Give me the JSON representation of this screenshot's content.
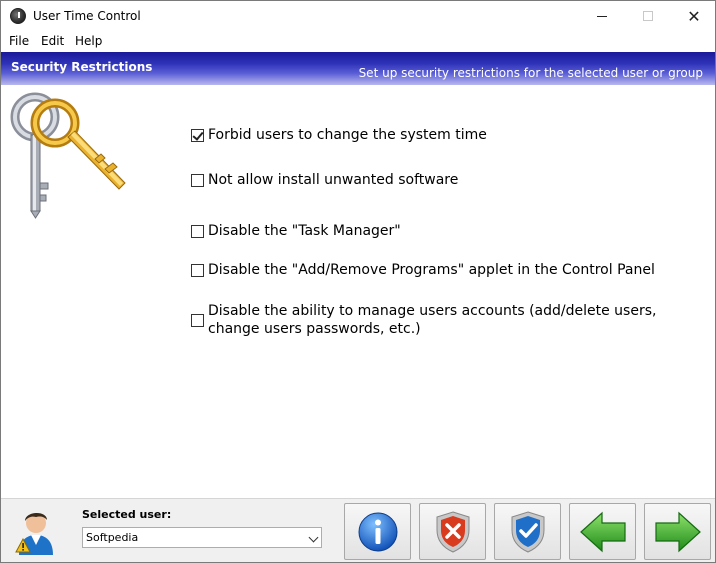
{
  "window": {
    "title": "User Time Control"
  },
  "menu": {
    "items": [
      "File",
      "Edit",
      "Help"
    ]
  },
  "header": {
    "title": "Security Restrictions",
    "subtitle": "Set up security restrictions for the selected user or group"
  },
  "options": [
    {
      "label": "Forbid users to change the system time",
      "checked": true
    },
    {
      "label": "Not allow install unwanted software",
      "checked": false
    },
    {
      "label": "Disable the \"Task Manager\"",
      "checked": false
    },
    {
      "label": "Disable the \"Add/Remove Programs\" applet in the Control Panel",
      "checked": false
    },
    {
      "label_line1": "Disable the ability to manage users accounts (add/delete users,",
      "label_line2": "change users passwords, etc.)",
      "checked": false
    }
  ],
  "footer": {
    "selected_user_label": "Selected user:",
    "selected_user_value": "Softpedia"
  },
  "buttons": {
    "info": "info-icon",
    "cancel": "shield-cancel-icon",
    "ok": "shield-ok-icon",
    "back": "arrow-left-icon",
    "next": "arrow-right-icon"
  },
  "colors": {
    "header_dark": "#1a1a99",
    "header_light": "#b8b9ee",
    "info_blue": "#1c6fd6",
    "cancel_red": "#d83b1e",
    "ok_blue": "#1f6fc9",
    "arrow_green": "#2fa52a"
  }
}
